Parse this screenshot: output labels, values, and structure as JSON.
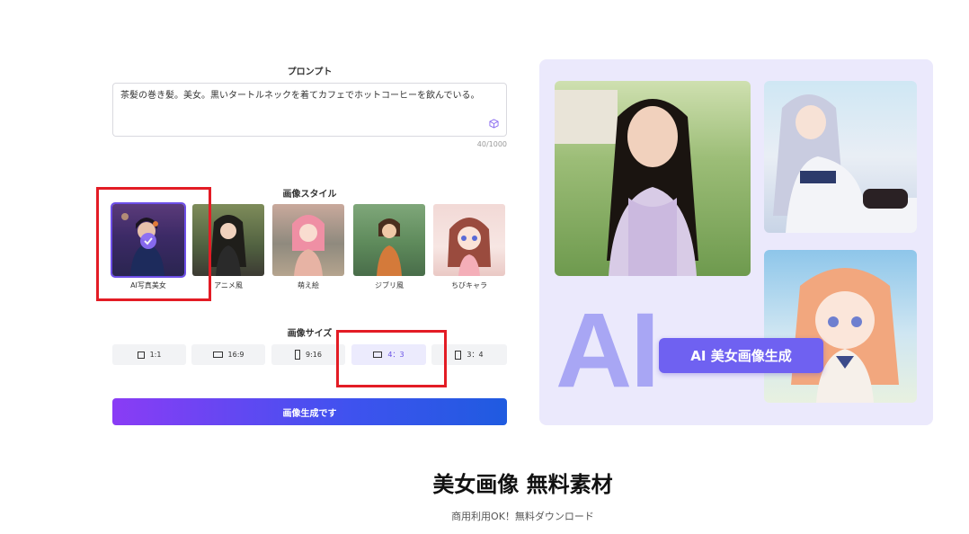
{
  "prompt": {
    "label": "プロンプト",
    "text": "茶髪の巻き髪。美女。黒いタートルネックを着てカフェでホットコーヒーを飲んでいる。",
    "counter": "40/1000",
    "icon": "cube-icon"
  },
  "style": {
    "label": "画像スタイル",
    "items": [
      {
        "label": "AI写真美女",
        "selected": true
      },
      {
        "label": "アニメ風",
        "selected": false
      },
      {
        "label": "萌え絵",
        "selected": false
      },
      {
        "label": "ジブリ風",
        "selected": false
      },
      {
        "label": "ちびキャラ",
        "selected": false
      }
    ]
  },
  "size": {
    "label": "画像サイズ",
    "options": [
      {
        "label": "1:1",
        "active": false
      },
      {
        "label": "16:9",
        "active": false
      },
      {
        "label": "9:16",
        "active": false
      },
      {
        "label": "4：3",
        "active": true
      },
      {
        "label": "3：4",
        "active": false
      }
    ]
  },
  "generate_button": "画像生成です",
  "hero": {
    "ai_text": "AI",
    "badge": "AI 美女画像生成"
  },
  "footer": {
    "title": "美女画像 無料素材",
    "subtitle": "商用利用OK！無料ダウンロード"
  },
  "colors": {
    "accent": "#6d4fe8",
    "highlight": "#e31c25",
    "panel_bg": "#ebe9fc"
  }
}
